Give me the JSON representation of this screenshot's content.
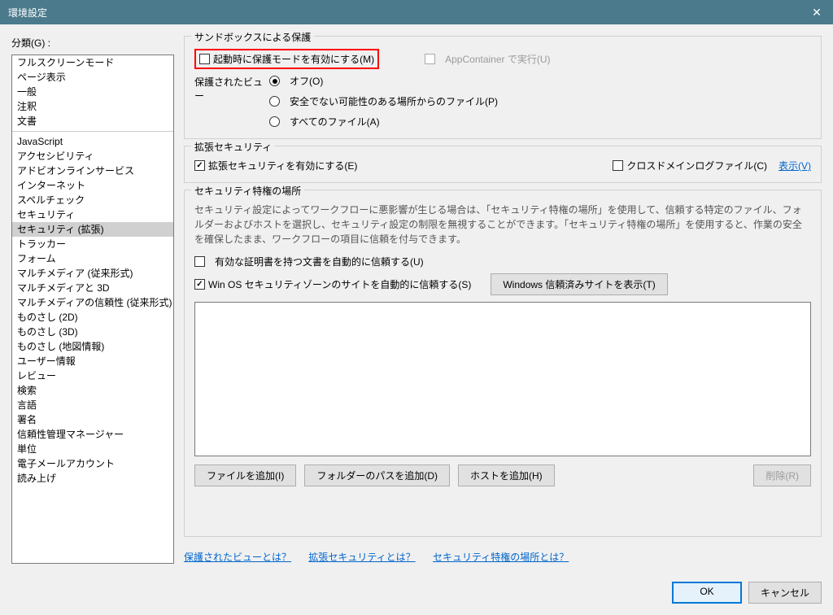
{
  "title": "環境設定",
  "left": {
    "label": "分類(G) :",
    "items_top": [
      "フルスクリーンモード",
      "ページ表示",
      "一般",
      "注釈",
      "文書"
    ],
    "items_bottom": [
      "JavaScript",
      "アクセシビリティ",
      "アドビオンラインサービス",
      "インターネット",
      "スペルチェック",
      "セキュリティ",
      "セキュリティ (拡張)",
      "トラッカー",
      "フォーム",
      "マルチメディア (従来形式)",
      "マルチメディアと 3D",
      "マルチメディアの信頼性 (従来形式)",
      "ものさし (2D)",
      "ものさし (3D)",
      "ものさし (地図情報)",
      "ユーザー情報",
      "レビュー",
      "検索",
      "言語",
      "署名",
      "信頼性管理マネージャー",
      "単位",
      "電子メールアカウント",
      "読み上げ"
    ],
    "selected": "セキュリティ (拡張)"
  },
  "sandbox": {
    "group": "サンドボックスによる保護",
    "cb_protected_mode": "起動時に保護モードを有効にする(M)",
    "cb_appcontainer": "AppContainer で実行(U)",
    "protected_view_label": "保護されたビュー",
    "radio_off": "オフ(O)",
    "radio_unsafe": "安全でない可能性のある場所からのファイル(P)",
    "radio_all": "すべてのファイル(A)"
  },
  "enhanced": {
    "group": "拡張セキュリティ",
    "cb_enable": "拡張セキュリティを有効にする(E)",
    "cb_crossdomain": "クロスドメインログファイル(C)",
    "show_link": "表示(V)"
  },
  "priv": {
    "group": "セキュリティ特権の場所",
    "help": "セキュリティ設定によってワークフローに悪影響が生じる場合は、「セキュリティ特権の場所」を使用して、信頼する特定のファイル、フォルダーおよびホストを選択し、セキュリティ設定の制限を無視することができます。「セキュリティ特権の場所」を使用すると、作業の安全を確保したまま、ワークフローの項目に信頼を付与できます。",
    "cb_trust_cert": "有効な証明書を持つ文書を自動的に信頼する(U)",
    "cb_trust_winos": "Win OS セキュリティゾーンのサイトを自動的に信頼する(S)",
    "btn_show_trusted": "Windows 信頼済みサイトを表示(T)",
    "btn_add_file": "ファイルを追加(I)",
    "btn_add_folder": "フォルダーのパスを追加(D)",
    "btn_add_host": "ホストを追加(H)",
    "btn_delete": "削除(R)"
  },
  "links": {
    "l1": "保護されたビューとは？",
    "l2": "拡張セキュリティとは？",
    "l3": "セキュリティ特権の場所とは？"
  },
  "footer": {
    "ok": "OK",
    "cancel": "キャンセル"
  }
}
